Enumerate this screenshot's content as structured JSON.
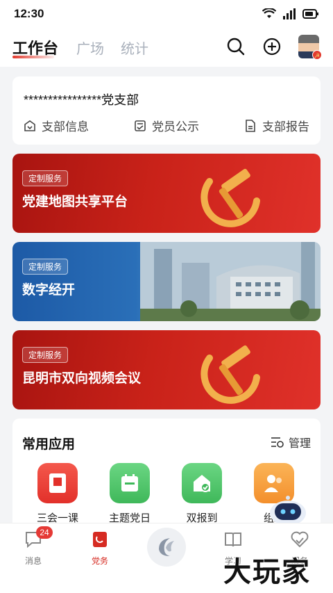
{
  "status": {
    "time": "12:30"
  },
  "tabs": [
    {
      "label": "工作台",
      "active": true
    },
    {
      "label": "广场",
      "active": false
    },
    {
      "label": "统计",
      "active": false
    }
  ],
  "branch": {
    "name": "****************党支部",
    "links": [
      {
        "label": "支部信息",
        "icon": "branch-info-icon"
      },
      {
        "label": "党员公示",
        "icon": "member-notice-icon"
      },
      {
        "label": "支部报告",
        "icon": "branch-report-icon"
      }
    ]
  },
  "banners": [
    {
      "tag": "定制服务",
      "title": "党建地图共享平台",
      "theme": "red"
    },
    {
      "tag": "定制服务",
      "title": "数字经开",
      "theme": "blue"
    },
    {
      "tag": "定制服务",
      "title": "昆明市双向视频会议",
      "theme": "red"
    }
  ],
  "apps": {
    "title": "常用应用",
    "manage_label": "管理",
    "items": [
      {
        "label": "三会一课",
        "color": "#f0453a"
      },
      {
        "label": "主题党日",
        "color": "#4cc568"
      },
      {
        "label": "双报到",
        "color": "#4cc568"
      },
      {
        "label": "组织",
        "color": "#f7a040"
      }
    ]
  },
  "bottom_nav": [
    {
      "label": "消息",
      "badge": "24",
      "active": false
    },
    {
      "label": "党务",
      "active": true
    },
    {
      "label": "",
      "active": false
    },
    {
      "label": "学习",
      "active": false
    },
    {
      "label": "服务",
      "active": false
    }
  ],
  "watermark": "大玩家",
  "colors": {
    "brand_red": "#d62b22",
    "blue": "#1d5aa6",
    "green": "#4cc568",
    "orange": "#f7a040"
  }
}
